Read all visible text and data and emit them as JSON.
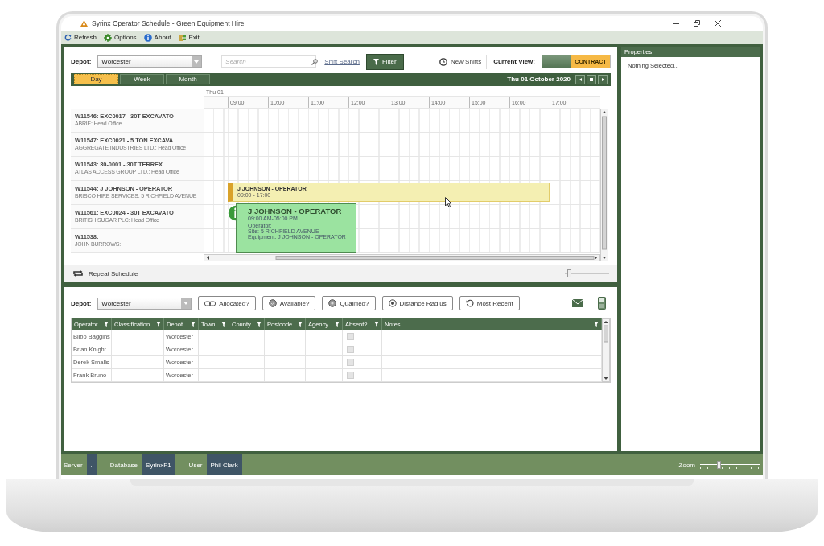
{
  "window": {
    "title": "Syrinx Operator Schedule - Green Equipment Hire"
  },
  "toolbar": [
    {
      "kind": "refresh",
      "label": "Refresh"
    },
    {
      "kind": "options",
      "label": "Options"
    },
    {
      "kind": "about",
      "label": "About"
    },
    {
      "kind": "exit",
      "label": "Exit"
    }
  ],
  "schedule": {
    "depot": {
      "label": "Depot:",
      "value": "Worcester"
    },
    "search": {
      "placeholder": "Search"
    },
    "shift_search": "Shift Search",
    "filter": "Filter",
    "new_shifts": "New Shifts",
    "current_view": {
      "label": "Current View:",
      "option": "CONTRACT"
    },
    "views": [
      {
        "label": "Day",
        "selected": true
      },
      {
        "label": "Week",
        "selected": false
      },
      {
        "label": "Month",
        "selected": false
      }
    ],
    "date": "Thu 01 October 2020",
    "day": "Thu 01",
    "hours": [
      "09:00",
      "10:00",
      "11:00",
      "12:00",
      "13:00",
      "14:00",
      "15:00",
      "16:00",
      "17:00"
    ],
    "rows": [
      {
        "title": "W11546: EXC0017 - 30T EXCAVATO",
        "subtitle": "ABRIE: Head Office"
      },
      {
        "title": "W11547: EXC0021 - 5 TON EXCAVA",
        "subtitle": "AGGREGATE INDUSTRIES LTD.: Head Office"
      },
      {
        "title": "W11543: 30-0001 - 30T TERREX",
        "subtitle": "ATLAS ACCESS GROUP LTD.: Head Office"
      },
      {
        "title": "W11544: J JOHNSON - OPERATOR",
        "subtitle": "BRISCO HIRE SERVICES: 5 RICHFIELD AVENUE",
        "event": {
          "title": "J JOHNSON - OPERATOR",
          "time": "09:00 - 17:00"
        }
      },
      {
        "title": "W11561: EXC0024 - 30T EXCAVATO",
        "subtitle": "BRITISH SUGAR PLC: Head Office"
      },
      {
        "title": "W11538:",
        "subtitle": "JOHN BURROWS:"
      }
    ],
    "tooltip": {
      "title": "J JOHNSON - OPERATOR",
      "time": "09:00 AM-05:00 PM",
      "lines": [
        "Operator:",
        "Site: 5 RICHFIELD AVENUE",
        "Equipment: J JOHNSON - OPERATOR"
      ]
    },
    "repeat": "Repeat Schedule",
    "zoom": {
      "level": 0.05
    }
  },
  "operators": {
    "depot": {
      "label": "Depot:",
      "value": "Worcester"
    },
    "filters": [
      {
        "kind": "allocated",
        "label": "Allocated?"
      },
      {
        "kind": "available",
        "label": "Available?"
      },
      {
        "kind": "qualified",
        "label": "Qualified?"
      },
      {
        "kind": "distance",
        "label": "Distance Radius"
      },
      {
        "kind": "recent",
        "label": "Most Recent"
      }
    ],
    "columns": [
      "Operator",
      "Classification",
      "Depot",
      "Town",
      "County",
      "Postcode",
      "Agency",
      "Absent?",
      "Notes"
    ],
    "rows": [
      {
        "operator": "Bilbo Baggins",
        "depot": "Worcester",
        "absent": false
      },
      {
        "operator": "Brian Knight",
        "depot": "Worcester",
        "absent": false
      },
      {
        "operator": "Derek Smalls",
        "depot": "Worcester",
        "absent": false
      },
      {
        "operator": "Frank Bruno",
        "depot": "Worcester",
        "absent": false
      }
    ]
  },
  "properties": {
    "title": "Properties",
    "text": "Nothing Selected..."
  },
  "status_bar": {
    "items": [
      {
        "label": "Server",
        "value": "."
      },
      {
        "label": "Database",
        "value": "SyrinxF1"
      },
      {
        "label": "User",
        "value": "Phil Clark"
      }
    ],
    "zoom": {
      "label": "Zoom",
      "level": 0.3
    }
  }
}
